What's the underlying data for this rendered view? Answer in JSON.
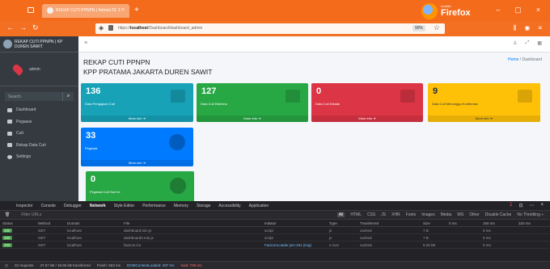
{
  "browser": {
    "tab_title": "REKAP CUTI PPNPN | AdminLTE 3",
    "url_prefix": "https://",
    "url_host": "localhost",
    "url_path": "/Dashboard/dashboard_admin",
    "zoom": "90%",
    "brand_small": "mozilla",
    "brand_big": "Firefox"
  },
  "sidebar": {
    "brand_title": "REKAP CUTI PPNPN | KP DUREN SAWIT",
    "user_name": "admin",
    "search_placeholder": "Search",
    "items": [
      {
        "label": "Dashboard",
        "icon": "dashboard-icon"
      },
      {
        "label": "Pegawai",
        "icon": "users-icon"
      },
      {
        "label": "Cuti",
        "icon": "calendar-icon"
      },
      {
        "label": "Rekap Data Cuti",
        "icon": "list-icon"
      },
      {
        "label": "Settings",
        "icon": "gear-icon"
      }
    ]
  },
  "page": {
    "title_line1": "REKAP CUTI PPNPN",
    "title_line2": "KPP PRATAMA JAKARTA DUREN SAWIT",
    "breadcrumb_home": "Home",
    "breadcrumb_sep": " / ",
    "breadcrumb_current": "Dashboard"
  },
  "boxes": [
    {
      "value": "136",
      "label": "Data Pengajuan Cuti",
      "footer": "More info ➜",
      "color": "#17a2b8"
    },
    {
      "value": "127",
      "label": "Data Cuti Diterima",
      "footer": "More info ➜",
      "color": "#28a745"
    },
    {
      "value": "0",
      "label": "Data Cuti Ditolak",
      "footer": "More info ➜",
      "color": "#dc3545"
    },
    {
      "value": "9",
      "label": "Data Cuti Menunggu Konfirmasi",
      "footer": "More info ➜",
      "color": "#ffc107"
    },
    {
      "value": "33",
      "label": "Pegawai",
      "footer": "More info ➜",
      "color": "#007bff"
    },
    {
      "value": "0",
      "label": "Pegawai Cuti Hari Ini",
      "footer": "",
      "color": "#28a745"
    }
  ],
  "devtools": {
    "tabs": [
      "Inspector",
      "Console",
      "Debugger",
      "Network",
      "Style Editor",
      "Performance",
      "Memory",
      "Storage",
      "Accessibility",
      "Application"
    ],
    "active_tab": "Network",
    "filter_placeholder": "Filter URLs",
    "types": [
      "All",
      "HTML",
      "CSS",
      "JS",
      "XHR",
      "Fonts",
      "Images",
      "Media",
      "WS",
      "Other"
    ],
    "options": [
      "Disable Cache",
      "No Throttling ÷"
    ],
    "error_count": "1",
    "columns": [
      "Status",
      "Method",
      "Domain",
      "File",
      "Initiator",
      "Type",
      "Transferred",
      "Size",
      "0 ms",
      "160 ms",
      "320 ms"
    ],
    "rows": [
      {
        "status": "200",
        "method": "GET",
        "domain": "localhost",
        "file": "dashboard.min.js",
        "initiator": "script",
        "type": "js",
        "transferred": "cached",
        "size": "7 B",
        "t": "0 ms"
      },
      {
        "status": "200",
        "method": "GET",
        "domain": "localhost",
        "file": "dashboard2.min.js",
        "initiator": "script",
        "type": "js",
        "transferred": "cached",
        "size": "7 B",
        "t": "0 ms"
      },
      {
        "status": "200",
        "method": "GET",
        "domain": "localhost",
        "file": "favicon.ico",
        "initiator": "FaviconLoader.jsm:191 (img)",
        "type": "x-icon",
        "transferred": "cached",
        "size": "5.25 kB",
        "t": "0 ms"
      }
    ],
    "status_bar": {
      "requests": "32 requests",
      "transferred": "47.67 kB / 18.95 kB transferred",
      "finish": "Finish: 563 ms",
      "dcl": "DOMContentLoaded: 297 ms",
      "load": "load: 709 ms"
    }
  }
}
